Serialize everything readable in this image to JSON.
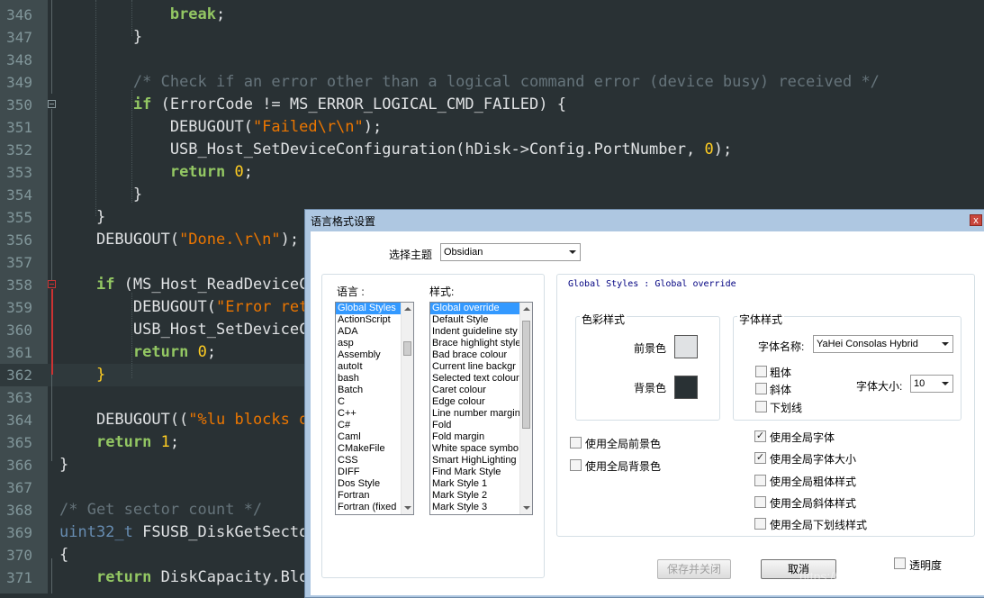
{
  "editor": {
    "lines": [
      {
        "num": "346",
        "parts": [
          {
            "t": "            ",
            "c": ""
          },
          {
            "t": "break",
            "c": "kw"
          },
          {
            "t": ";",
            "c": ""
          }
        ]
      },
      {
        "num": "347",
        "parts": [
          {
            "t": "        }",
            "c": ""
          }
        ]
      },
      {
        "num": "348",
        "parts": []
      },
      {
        "num": "349",
        "parts": [
          {
            "t": "        ",
            "c": ""
          },
          {
            "t": "/* Check if an error other than a logical command error (device busy) received */",
            "c": "cmt"
          }
        ]
      },
      {
        "num": "350",
        "parts": [
          {
            "t": "        ",
            "c": ""
          },
          {
            "t": "if",
            "c": "kw"
          },
          {
            "t": " (ErrorCode != MS_ERROR_LOGICAL_CMD_FAILED) {",
            "c": ""
          }
        ]
      },
      {
        "num": "351",
        "parts": [
          {
            "t": "            DEBUGOUT(",
            "c": ""
          },
          {
            "t": "\"Failed\\r\\n\"",
            "c": "str"
          },
          {
            "t": ");",
            "c": ""
          }
        ]
      },
      {
        "num": "352",
        "parts": [
          {
            "t": "            USB_Host_SetDeviceConfiguration(hDisk->Config.PortNumber, ",
            "c": ""
          },
          {
            "t": "0",
            "c": "num-lit"
          },
          {
            "t": ");",
            "c": ""
          }
        ]
      },
      {
        "num": "353",
        "parts": [
          {
            "t": "            ",
            "c": ""
          },
          {
            "t": "return",
            "c": "kw"
          },
          {
            "t": " ",
            "c": ""
          },
          {
            "t": "0",
            "c": "num-lit"
          },
          {
            "t": ";",
            "c": ""
          }
        ]
      },
      {
        "num": "354",
        "parts": [
          {
            "t": "        }",
            "c": ""
          }
        ]
      },
      {
        "num": "355",
        "parts": [
          {
            "t": "    }",
            "c": ""
          }
        ]
      },
      {
        "num": "356",
        "parts": [
          {
            "t": "    DEBUGOUT(",
            "c": ""
          },
          {
            "t": "\"Done.\\r\\n\"",
            "c": "str"
          },
          {
            "t": ");",
            "c": ""
          }
        ]
      },
      {
        "num": "357",
        "parts": []
      },
      {
        "num": "358",
        "parts": [
          {
            "t": "    ",
            "c": ""
          },
          {
            "t": "if",
            "c": "kw"
          },
          {
            "t": " (MS_Host_ReadDeviceC",
            "c": ""
          }
        ]
      },
      {
        "num": "359",
        "parts": [
          {
            "t": "        DEBUGOUT(",
            "c": ""
          },
          {
            "t": "\"Error ret",
            "c": "str"
          }
        ]
      },
      {
        "num": "360",
        "parts": [
          {
            "t": "        USB_Host_SetDeviceC",
            "c": ""
          }
        ]
      },
      {
        "num": "361",
        "parts": [
          {
            "t": "        ",
            "c": ""
          },
          {
            "t": "return",
            "c": "kw"
          },
          {
            "t": " ",
            "c": ""
          },
          {
            "t": "0",
            "c": "num-lit"
          },
          {
            "t": ";",
            "c": ""
          }
        ]
      },
      {
        "num": "362",
        "parts": [
          {
            "t": "    }",
            "c": "num-lit"
          }
        ]
      },
      {
        "num": "363",
        "parts": []
      },
      {
        "num": "364",
        "parts": [
          {
            "t": "    DEBUGOUT((",
            "c": ""
          },
          {
            "t": "\"%lu blocks o",
            "c": "str"
          }
        ]
      },
      {
        "num": "365",
        "parts": [
          {
            "t": "    ",
            "c": ""
          },
          {
            "t": "return",
            "c": "kw"
          },
          {
            "t": " ",
            "c": ""
          },
          {
            "t": "1",
            "c": "num-lit"
          },
          {
            "t": ";",
            "c": ""
          }
        ]
      },
      {
        "num": "366",
        "parts": [
          {
            "t": "}",
            "c": ""
          }
        ]
      },
      {
        "num": "367",
        "parts": []
      },
      {
        "num": "368",
        "parts": [
          {
            "t": "/* Get sector count */",
            "c": "cmt"
          }
        ]
      },
      {
        "num": "369",
        "parts": [
          {
            "t": "uint32_t",
            "c": "type"
          },
          {
            "t": " FSUSB_DiskGetSecto",
            "c": ""
          }
        ]
      },
      {
        "num": "370",
        "parts": [
          {
            "t": "{",
            "c": ""
          }
        ]
      },
      {
        "num": "371",
        "parts": [
          {
            "t": "    ",
            "c": ""
          },
          {
            "t": "return",
            "c": "kw"
          },
          {
            "t": " DiskCapacity.Blo",
            "c": ""
          }
        ]
      }
    ]
  },
  "dialog": {
    "title": "语言格式设置",
    "close_label": "x",
    "theme_label": "选择主题",
    "theme_value": "Obsidian",
    "language_label": "语言 :",
    "style_label": "样式:",
    "languages": [
      "Global Styles",
      "ActionScript",
      "ADA",
      "asp",
      "Assembly",
      "autoIt",
      "bash",
      "Batch",
      "C",
      "C++",
      "C#",
      "Caml",
      "CMakeFile",
      "CSS",
      "DIFF",
      "Dos Style",
      "Fortran",
      "Fortran (fixed"
    ],
    "styles": [
      "Global override",
      "Default Style",
      "Indent guideline sty",
      "Brace highlight style",
      "Bad brace colour",
      "Current line backgr",
      "Selected text colour",
      "Caret colour",
      "Edge colour",
      "Line number margin",
      "Fold",
      "Fold margin",
      "White space symbo",
      "Smart HighLighting",
      "Find Mark Style",
      "Mark Style 1",
      "Mark Style 2",
      "Mark Style 3"
    ],
    "style_header": "Global Styles : Global override",
    "color_group_label": "色彩样式",
    "fg_label": "前景色",
    "bg_label": "背景色",
    "fg_color": "#e0e2e4",
    "bg_color": "#293134",
    "font_group_label": "字体样式",
    "font_name_label": "字体名称:",
    "font_name_value": "YaHei Consolas Hybrid",
    "bold_label": "粗体",
    "italic_label": "斜体",
    "underline_label": "下划线",
    "font_size_label": "字体大小:",
    "font_size_value": "10",
    "use_global_fg": "使用全局前景色",
    "use_global_bg": "使用全局背景色",
    "use_global_font": "使用全局字体",
    "use_global_font_size": "使用全局字体大小",
    "use_global_bold": "使用全局粗体样式",
    "use_global_italic": "使用全局斜体样式",
    "use_global_underline": "使用全局下划线样式",
    "check_mark": "✓",
    "save_close_label": "保存并关闭",
    "cancel_label": "取消",
    "transparency_label": "透明度"
  },
  "watermark": "https://blog.csdn.net/lijiaoal"
}
